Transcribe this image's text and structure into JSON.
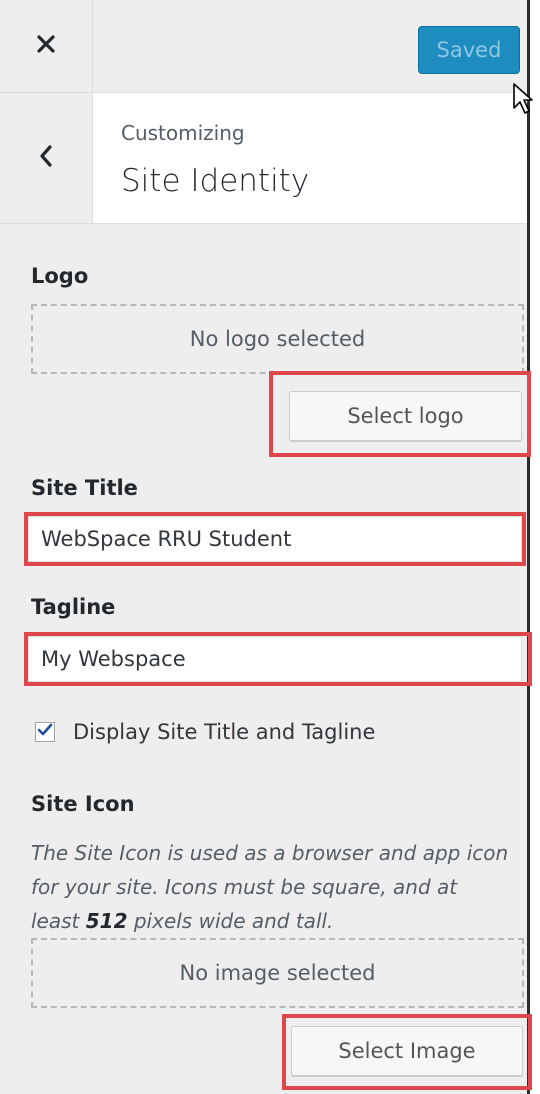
{
  "header": {
    "close_icon": "close-icon",
    "saved_label": "Saved"
  },
  "section": {
    "back_icon": "chevron-left-icon",
    "breadcrumb": "Customizing",
    "title": "Site Identity"
  },
  "logo": {
    "label": "Logo",
    "placeholder": "No logo selected",
    "button_label": "Select logo"
  },
  "site_title": {
    "label": "Site Title",
    "value": "WebSpace RRU Student"
  },
  "tagline": {
    "label": "Tagline",
    "value": "My Webspace"
  },
  "display_option": {
    "label": "Display Site Title and Tagline",
    "checked": true
  },
  "site_icon": {
    "label": "Site Icon",
    "description_before": "The Site Icon is used as a browser and app icon for your site. Icons must be square, and at least ",
    "description_bold": "512",
    "description_after": " pixels wide and tall.",
    "placeholder": "No image selected",
    "button_label": "Select Image"
  },
  "colors": {
    "accent": "#1e8cbe",
    "highlight": "#e0474c",
    "panel_bg": "#eeeeee"
  }
}
